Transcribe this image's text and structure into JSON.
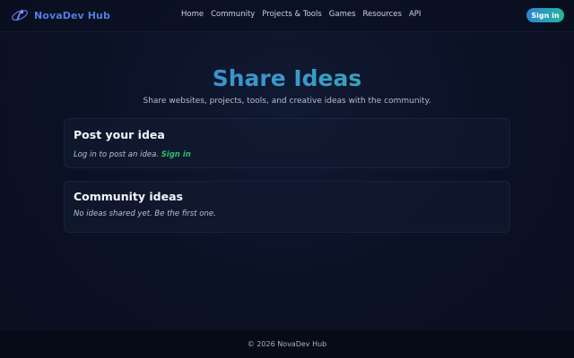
{
  "header": {
    "brand": "NovaDev Hub",
    "logo_icon": "nova-logo-icon",
    "nav": [
      "Home",
      "Community",
      "Projects & Tools",
      "Games",
      "Resources",
      "API"
    ],
    "signin_label": "Sign in"
  },
  "hero": {
    "title": "Share Ideas",
    "subtitle": "Share websites, projects, tools, and creative ideas with the community."
  },
  "post_card": {
    "title": "Post your idea",
    "prompt_text": "Log in to post an idea.",
    "signin_link": "Sign in"
  },
  "ideas_card": {
    "title": "Community ideas",
    "empty_text": "No ideas shared yet. Be the first one."
  },
  "footer": {
    "copyright": "© 2026 NovaDev Hub"
  },
  "colors": {
    "background": "#0b1124",
    "brand": "#4f7fe0",
    "accent_green": "#2fbf6a",
    "gradient_start": "#3f82ea",
    "gradient_end": "#2fbf8c"
  }
}
